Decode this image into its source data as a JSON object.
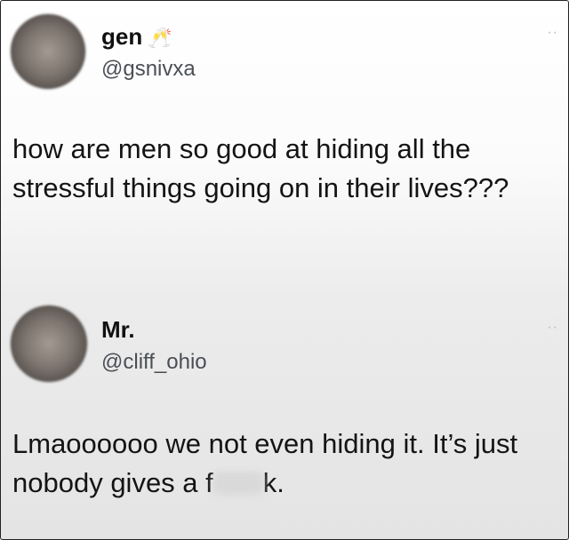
{
  "posts": [
    {
      "display_name": "gen",
      "name_emoji": "🥂",
      "handle": "@gsnivxa",
      "text": "how are men so good at hiding all the stressful things going on in their lives???",
      "more_icon": "ellipsis-icon",
      "more_glyph": "··"
    },
    {
      "display_name": "Mr.",
      "handle": "@cliff_ohio",
      "text_before": "Lmaoooooo we not even hiding it. It’s just nobody gives a f",
      "text_after": "k.",
      "more_icon": "ellipsis-icon",
      "more_glyph": "··"
    }
  ]
}
